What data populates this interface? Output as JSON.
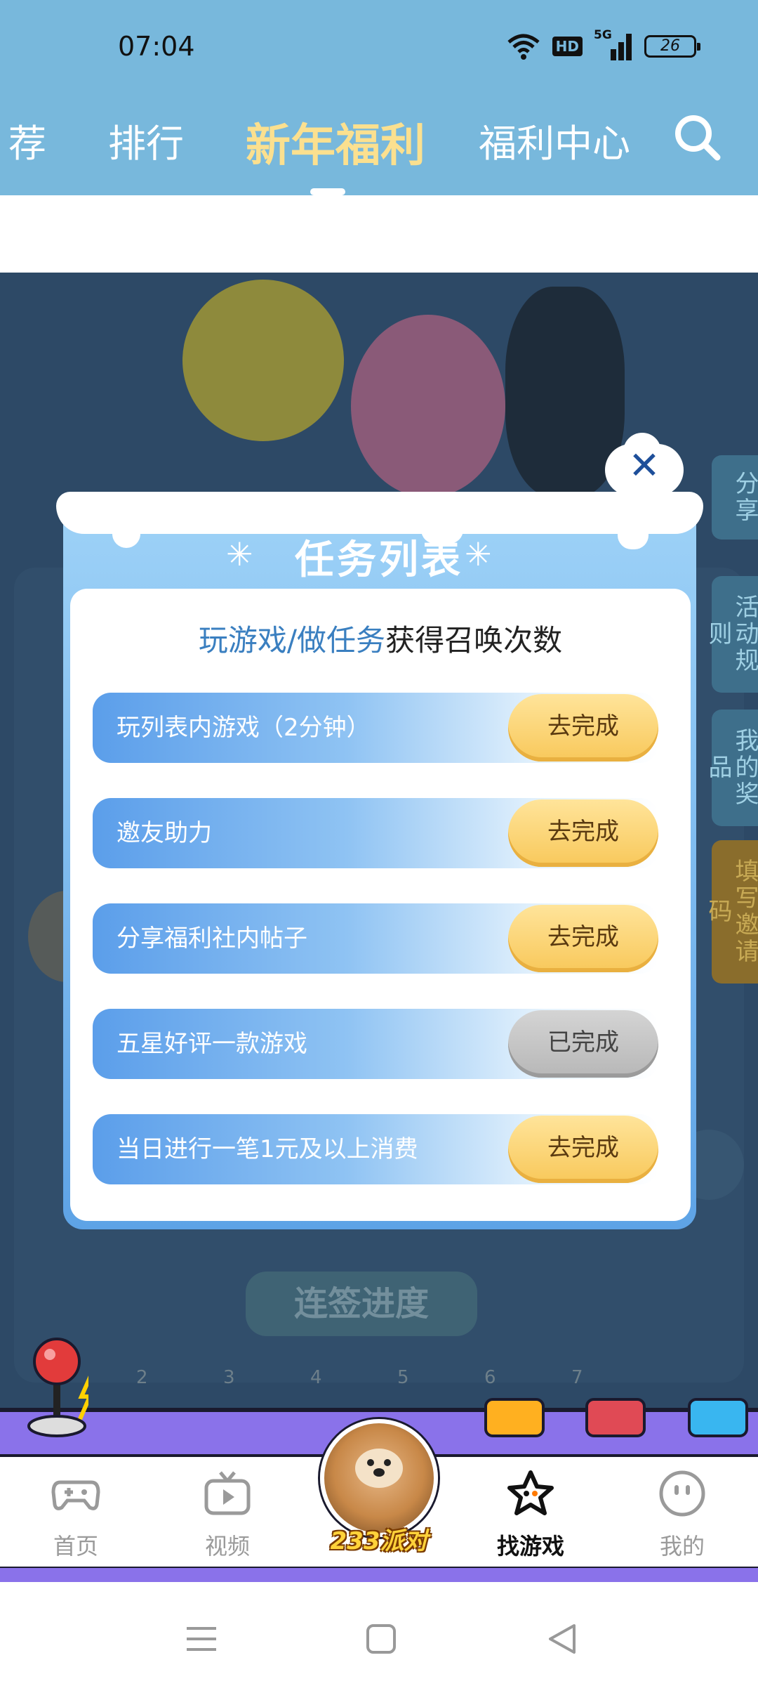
{
  "status_bar": {
    "time": "07:04",
    "hd_label": "HD",
    "network": "5G",
    "battery": "26"
  },
  "tabs": [
    {
      "label": "荐"
    },
    {
      "label": "排行"
    },
    {
      "label": "新年福利",
      "active": true
    },
    {
      "label": "福利中心"
    }
  ],
  "side_tabs": {
    "share": "分享",
    "rules": "活动规则",
    "prizes": "我的奖品",
    "invite": "填写邀请码"
  },
  "background": {
    "progress_title": "连签进度",
    "days": [
      "2",
      "3",
      "4",
      "5",
      "6",
      "7"
    ]
  },
  "modal": {
    "title": "任务列表",
    "close_label": "✕",
    "subtitle_highlight": "玩游戏/做任务",
    "subtitle_rest": "获得召唤次数",
    "tasks": [
      {
        "label": "玩列表内游戏（2分钟）",
        "button": "去完成",
        "status": "pending"
      },
      {
        "label": "邀友助力",
        "button": "去完成",
        "status": "pending"
      },
      {
        "label": "分享福利社内帖子",
        "button": "去完成",
        "status": "pending"
      },
      {
        "label": "五星好评一款游戏",
        "button": "已完成",
        "status": "done"
      },
      {
        "label": "当日进行一笔1元及以上消费",
        "button": "去完成",
        "status": "pending"
      }
    ]
  },
  "bottom_nav": {
    "items": [
      {
        "label": "首页",
        "icon": "gamepad-icon"
      },
      {
        "label": "视频",
        "icon": "tv-icon"
      },
      {
        "label": "找游戏",
        "icon": "star-icon",
        "active": true
      },
      {
        "label": "我的",
        "icon": "smiley-icon"
      }
    ],
    "center_label": "233派对"
  },
  "colors": {
    "header_bg": "#78b8dc",
    "active_tab": "#fbe08f",
    "task_button": "#f8c85a",
    "done_button": "#b7b7b7",
    "highlight_text": "#3a7fc0",
    "nav_strip": "#8a72ea"
  }
}
